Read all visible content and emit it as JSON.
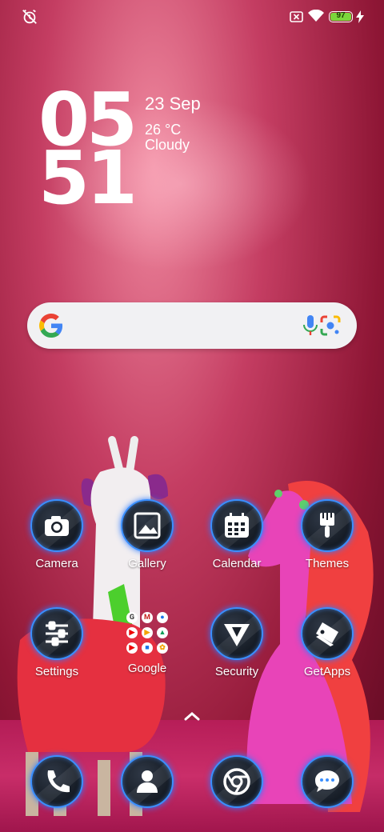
{
  "status": {
    "battery_level": "97",
    "battery_color": "#7cd63b",
    "icons": [
      "alarm-off-icon",
      "sim-off-icon",
      "wifi-icon",
      "battery-icon",
      "charging-icon"
    ]
  },
  "clock": {
    "hour": "05",
    "minute": "51",
    "date": "23 Sep",
    "temperature": "26 °C",
    "condition": "Cloudy"
  },
  "search": {
    "placeholder": "",
    "icons": [
      "google-g-icon",
      "mic-icon",
      "lens-icon"
    ]
  },
  "apps": [
    {
      "label": "Camera",
      "icon": "camera-icon"
    },
    {
      "label": "Gallery",
      "icon": "gallery-icon"
    },
    {
      "label": "Calendar",
      "icon": "calendar-icon"
    },
    {
      "label": "Themes",
      "icon": "paintbrush-icon"
    },
    {
      "label": "Settings",
      "icon": "sliders-icon"
    },
    {
      "label": "Google",
      "icon": "google-folder-icon"
    },
    {
      "label": "Security",
      "icon": "shield-triangle-icon"
    },
    {
      "label": "GetApps",
      "icon": "getapps-icon"
    }
  ],
  "dock": [
    {
      "icon": "phone-icon"
    },
    {
      "icon": "contacts-icon"
    },
    {
      "icon": "chrome-icon"
    },
    {
      "icon": "messages-icon"
    }
  ],
  "accent": "#3a8fff"
}
